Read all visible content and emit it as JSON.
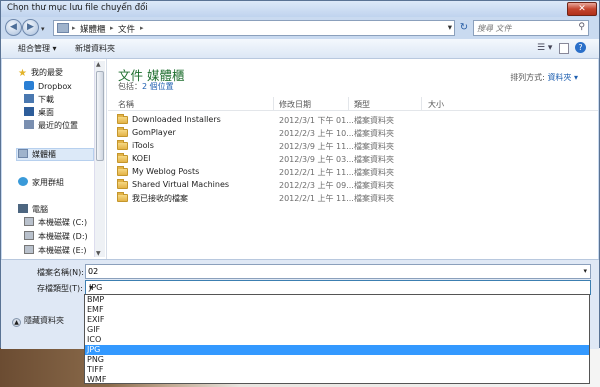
{
  "window": {
    "title": "Chọn thư mục lưu file chuyển đổi"
  },
  "nav": {
    "breadcrumb": [
      "媒體櫃",
      "文件"
    ],
    "search_placeholder": "搜尋 文件"
  },
  "toolbar": {
    "organize": "組合管理 ▾",
    "new_folder": "新增資料夾"
  },
  "sidebar": {
    "favorites": "我的最愛",
    "items": [
      "Dropbox",
      "下載",
      "桌面",
      "最近的位置"
    ],
    "libraries": "媒體櫃",
    "homegroup": "家用群組",
    "computer": "電腦",
    "drives": [
      "本機磁碟 (C:)",
      "本機磁碟 (D:)",
      "本機磁碟 (E:)"
    ]
  },
  "library": {
    "title": "文件 媒體櫃",
    "includes_label": "包括：",
    "includes_value": "2 個位置",
    "arrange_label": "排列方式:",
    "arrange_value": "資料夾 ▾"
  },
  "columns": {
    "name": "名稱",
    "modified": "修改日期",
    "type": "類型",
    "size": "大小"
  },
  "files": [
    {
      "name": "Downloaded Installers",
      "date": "2012/3/1 下午 01...",
      "type": "檔案資料夾"
    },
    {
      "name": "GomPlayer",
      "date": "2012/2/3 上午 10...",
      "type": "檔案資料夾"
    },
    {
      "name": "iTools",
      "date": "2012/3/9 上午 11...",
      "type": "檔案資料夾"
    },
    {
      "name": "KOEI",
      "date": "2012/3/9 上午 03...",
      "type": "檔案資料夾"
    },
    {
      "name": "My Weblog Posts",
      "date": "2012/2/1 上午 11...",
      "type": "檔案資料夾"
    },
    {
      "name": "Shared Virtual Machines",
      "date": "2012/2/3 上午 09...",
      "type": "檔案資料夾"
    },
    {
      "name": "我已接收的檔案",
      "date": "2012/2/1 上午 11...",
      "type": "檔案資料夾"
    }
  ],
  "form": {
    "filename_label": "檔案名稱(N):",
    "filename_value": "02",
    "filetype_label": "存檔類型(T):",
    "filetype_value": "JPG",
    "hide_folders": "隱藏資料夾"
  },
  "filetype_options": [
    "BMP",
    "EMF",
    "EXIF",
    "GIF",
    "ICO",
    "JPG",
    "PNG",
    "TIFF",
    "WMF"
  ],
  "selected_option_index": 5,
  "colors": {
    "selection": "#3399ff",
    "library_title": "#1e6e2e",
    "link": "#1e5fb0"
  }
}
